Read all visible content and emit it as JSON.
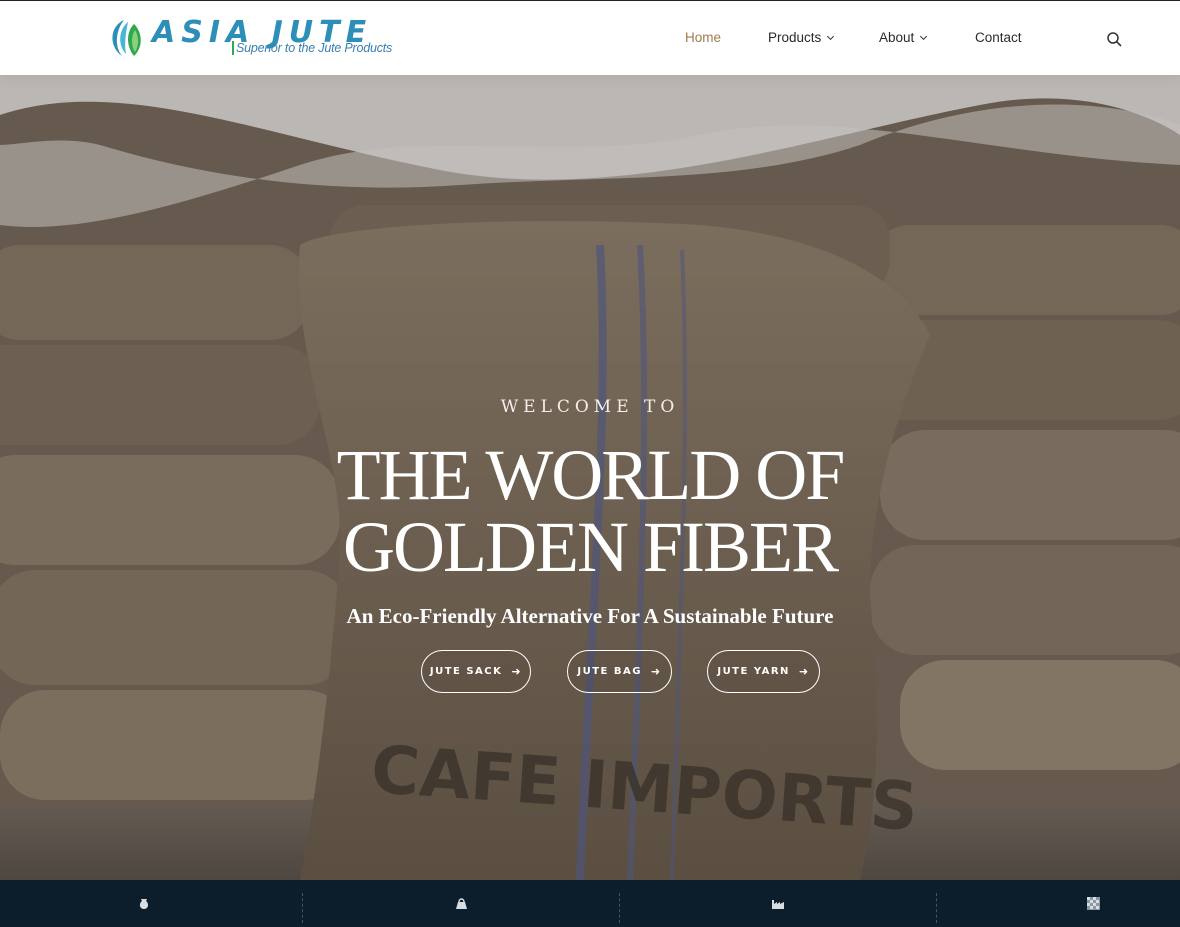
{
  "header": {
    "logo": {
      "brand": "ASIA JUTE",
      "tagline": "Superior to the Jute Products"
    },
    "nav": [
      {
        "label": "Home",
        "active": true
      },
      {
        "label": "Products",
        "has_dropdown": true
      },
      {
        "label": "About",
        "has_dropdown": true
      },
      {
        "label": "Contact"
      }
    ],
    "search_icon": "search-icon"
  },
  "hero": {
    "eyebrow": "WELCOME TO",
    "title_line1": "THE WORLD OF",
    "title_line2": "GOLDEN FIBER",
    "subtitle": "An Eco-Friendly Alternative For A Sustainable Future",
    "buttons": [
      {
        "label": "JUTE SACK",
        "icon": "arrow-right-icon"
      },
      {
        "label": "JUTE BAG",
        "icon": "arrow-right-icon"
      },
      {
        "label": "JUTE YARN",
        "icon": "arrow-right-icon"
      }
    ]
  },
  "bottom_bar": {
    "icons": [
      "sack-icon",
      "bag-icon",
      "factory-icon",
      "pattern-icon"
    ]
  },
  "colors": {
    "nav_active": "#a07c4c",
    "logo_blue": "#2d8fb8",
    "logo_green": "#2fa84f",
    "bottom_bar": "#0c1e2c"
  }
}
